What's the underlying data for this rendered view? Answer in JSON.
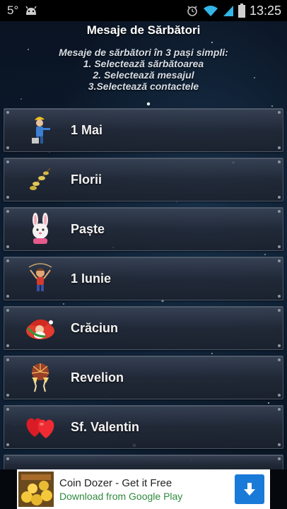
{
  "status_bar": {
    "temperature": "5°",
    "time": "13:25",
    "icons": [
      "android-icon",
      "alarm-icon",
      "wifi-icon",
      "signal-icon",
      "battery-icon"
    ]
  },
  "app": {
    "title": "Mesaje de Sărbători"
  },
  "instructions": {
    "line1": "Mesaje de sărbători în 3 pași simpli:",
    "line2": "1. Selectează sărbătoarea",
    "line3": "2. Selectează mesajul",
    "line4": "3.Selectează contactele"
  },
  "holidays": [
    {
      "label": "1 Mai",
      "icon": "worker-icon"
    },
    {
      "label": "Florii",
      "icon": "willow-branch-icon"
    },
    {
      "label": "Paște",
      "icon": "bunny-icon"
    },
    {
      "label": "1 Iunie",
      "icon": "child-icon"
    },
    {
      "label": "Crăciun",
      "icon": "santa-icon"
    },
    {
      "label": "Revelion",
      "icon": "champagne-icon"
    },
    {
      "label": "Sf. Valentin",
      "icon": "hearts-icon"
    }
  ],
  "ad": {
    "title": "Coin Dozer - Get it Free",
    "subtitle": "Download from Google Play",
    "button_icon": "download-arrow-icon",
    "accent": "#1a7ad8"
  }
}
